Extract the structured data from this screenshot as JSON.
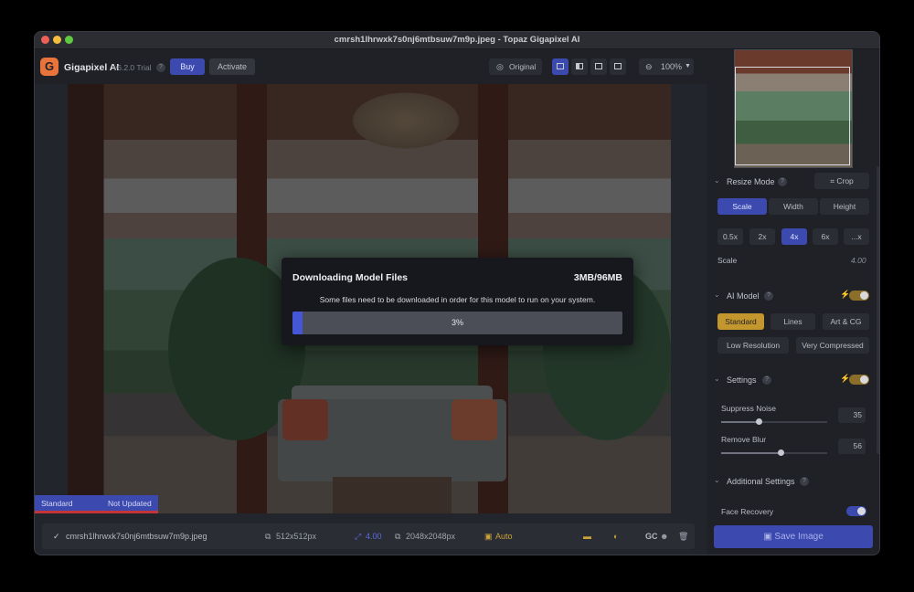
{
  "window": {
    "title": "cmrsh1lhrwxk7s0nj6mtbsuw7m9p.jpeg - Topaz Gigapixel AI"
  },
  "toolbar": {
    "app_name": "Gigapixel AI",
    "version": "v6.2.0 Trial",
    "help": "?",
    "buy_label": "Buy",
    "activate_label": "Activate",
    "original_label": "Original",
    "zoom": "100%",
    "logo_letter": "G"
  },
  "canvas": {
    "model_badge": "Standard",
    "status_badge": "Not Updated"
  },
  "modal": {
    "title": "Downloading Model Files",
    "size": "3MB/96MB",
    "message": "Some files need to be downloaded in order for this model to run on your system.",
    "progress_label": "3%",
    "progress_fraction": 0.03
  },
  "bottombar": {
    "filename": "cmrsh1lhrwxk7s0nj6mtbsuw7m9p.jpeg",
    "source_size": "512x512px",
    "scale": "4.00",
    "output_size": "2048x2048px",
    "auto_label": "Auto",
    "gc_label": "GC"
  },
  "panel": {
    "resize_mode": {
      "title": "Resize Mode",
      "crop_label": "Crop",
      "tabs": [
        "Scale",
        "Width",
        "Height"
      ],
      "scale_options": [
        "0.5x",
        "2x",
        "4x",
        "6x",
        "...x"
      ],
      "scale_label": "Scale",
      "scale_value": "4.00"
    },
    "ai_model": {
      "title": "AI Model",
      "models": [
        "Standard",
        "Lines",
        "Art & CG",
        "Low Resolution",
        "Very Compressed"
      ]
    },
    "settings": {
      "title": "Settings",
      "suppress_noise_label": "Suppress Noise",
      "suppress_noise_value": "35",
      "suppress_noise_level": 0.35,
      "remove_blur_label": "Remove Blur",
      "remove_blur_value": "56",
      "remove_blur_level": 0.56
    },
    "additional": {
      "title": "Additional Settings",
      "face_recovery_label": "Face Recovery"
    },
    "save_label": "Save Image"
  },
  "colors": {
    "accent": "#3c4ab0",
    "gold": "#c4962e",
    "progress": "#4657d6"
  }
}
